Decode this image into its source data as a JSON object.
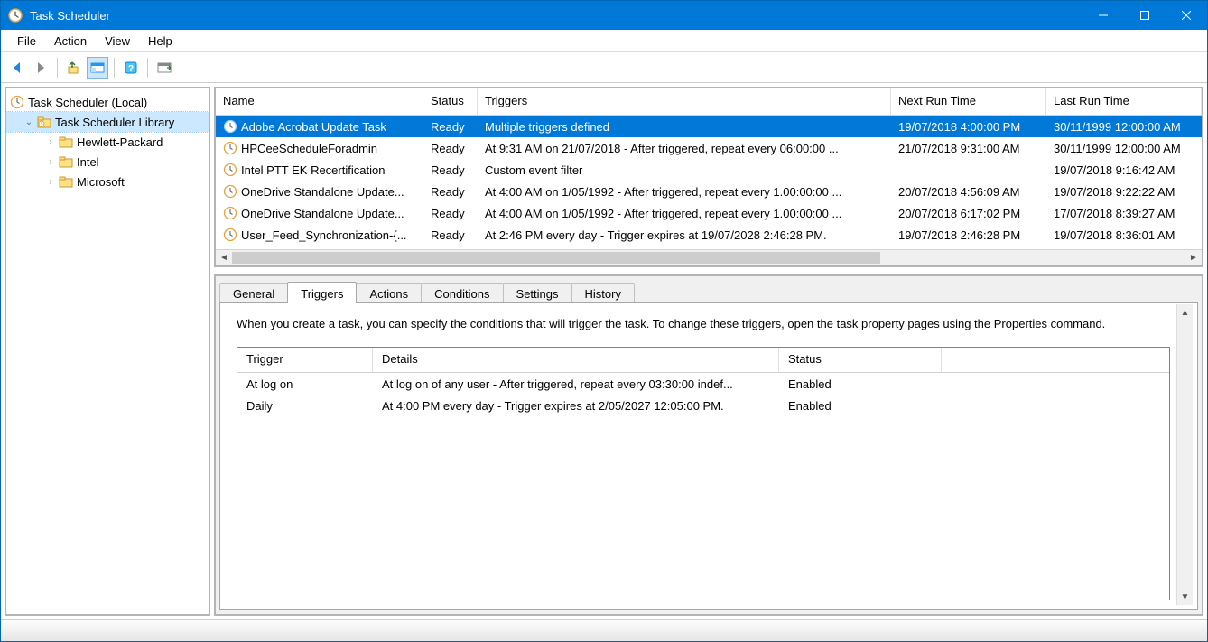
{
  "window": {
    "title": "Task Scheduler"
  },
  "menu": {
    "file": "File",
    "action": "Action",
    "view": "View",
    "help": "Help"
  },
  "tree": {
    "root": "Task Scheduler (Local)",
    "library": "Task Scheduler Library",
    "children": [
      "Hewlett-Packard",
      "Intel",
      "Microsoft"
    ]
  },
  "taskColumns": {
    "name": "Name",
    "status": "Status",
    "triggers": "Triggers",
    "nextRun": "Next Run Time",
    "lastRun": "Last Run Time"
  },
  "tasks": [
    {
      "name": "Adobe Acrobat Update Task",
      "status": "Ready",
      "triggers": "Multiple triggers defined",
      "next": "19/07/2018 4:00:00 PM",
      "last": "30/11/1999 12:00:00 AM",
      "selected": true
    },
    {
      "name": "HPCeeScheduleForadmin",
      "status": "Ready",
      "triggers": "At 9:31 AM on 21/07/2018 - After triggered, repeat every 06:00:00 ...",
      "next": "21/07/2018 9:31:00 AM",
      "last": "30/11/1999 12:00:00 AM"
    },
    {
      "name": "Intel PTT EK Recertification",
      "status": "Ready",
      "triggers": "Custom event filter",
      "next": "",
      "last": "19/07/2018 9:16:42 AM"
    },
    {
      "name": "OneDrive Standalone Update...",
      "status": "Ready",
      "triggers": "At 4:00 AM on 1/05/1992 - After triggered, repeat every 1.00:00:00 ...",
      "next": "20/07/2018 4:56:09 AM",
      "last": "19/07/2018 9:22:22 AM"
    },
    {
      "name": "OneDrive Standalone Update...",
      "status": "Ready",
      "triggers": "At 4:00 AM on 1/05/1992 - After triggered, repeat every 1.00:00:00 ...",
      "next": "20/07/2018 6:17:02 PM",
      "last": "17/07/2018 8:39:27 AM"
    },
    {
      "name": "User_Feed_Synchronization-{...",
      "status": "Ready",
      "triggers": "At 2:46 PM every day - Trigger expires at 19/07/2028 2:46:28 PM.",
      "next": "19/07/2018 2:46:28 PM",
      "last": "19/07/2018 8:36:01 AM"
    }
  ],
  "detailTabs": {
    "general": "General",
    "triggers": "Triggers",
    "actions": "Actions",
    "conditions": "Conditions",
    "settings": "Settings",
    "history": "History"
  },
  "triggersTab": {
    "description": "When you create a task, you can specify the conditions that will trigger the task.  To change these triggers, open the task property pages using the Properties command.",
    "columns": {
      "trigger": "Trigger",
      "details": "Details",
      "status": "Status"
    },
    "rows": [
      {
        "trigger": "At log on",
        "details": "At log on of any user - After triggered, repeat every 03:30:00 indef...",
        "status": "Enabled"
      },
      {
        "trigger": "Daily",
        "details": "At 4:00 PM every day - Trigger expires at 2/05/2027 12:05:00 PM.",
        "status": "Enabled"
      }
    ]
  }
}
